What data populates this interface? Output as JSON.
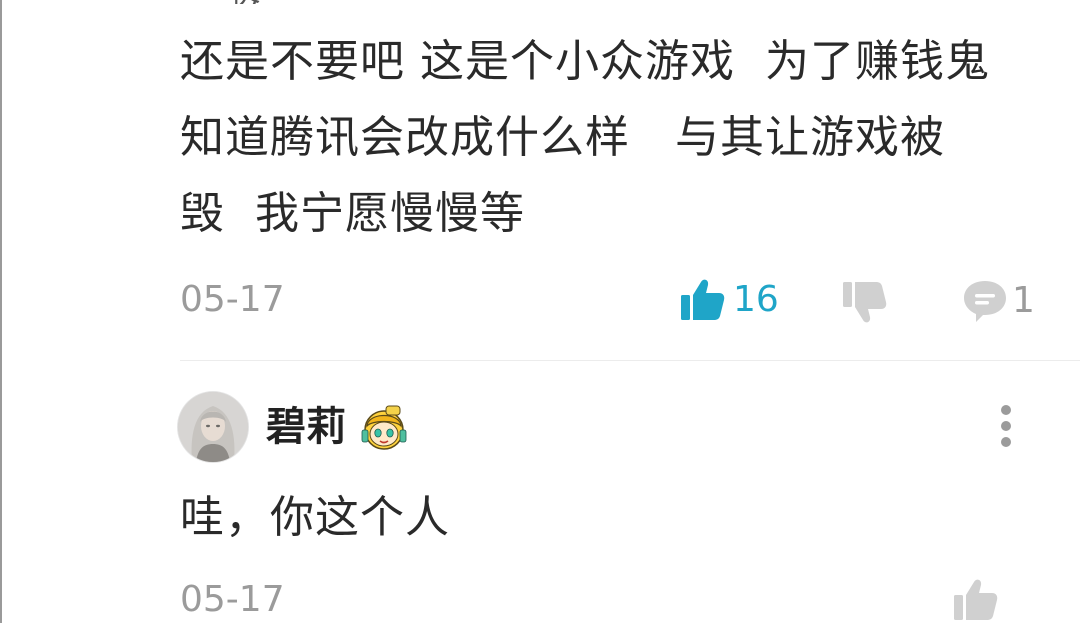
{
  "comments": [
    {
      "text": "还是不要吧 这是个小众游戏  为了赚钱鬼\n知道腾讯会改成什么样   与其让游戏被\n毁  我宁愿慢慢等",
      "date": "05-17",
      "like_count": "16",
      "reply_count": "1"
    },
    {
      "username": "碧莉",
      "text": "哇，你这个人",
      "date": "05-17"
    }
  ],
  "colors": {
    "accent": "#1fa5c8",
    "muted": "#9b9b9b",
    "icon_gray": "#d0d0d0",
    "text": "#2a2a2a"
  },
  "icons": [
    "thumbs-up-icon",
    "thumbs-down-icon",
    "reply-icon",
    "more-vertical-icon",
    "level-badge-icon"
  ]
}
